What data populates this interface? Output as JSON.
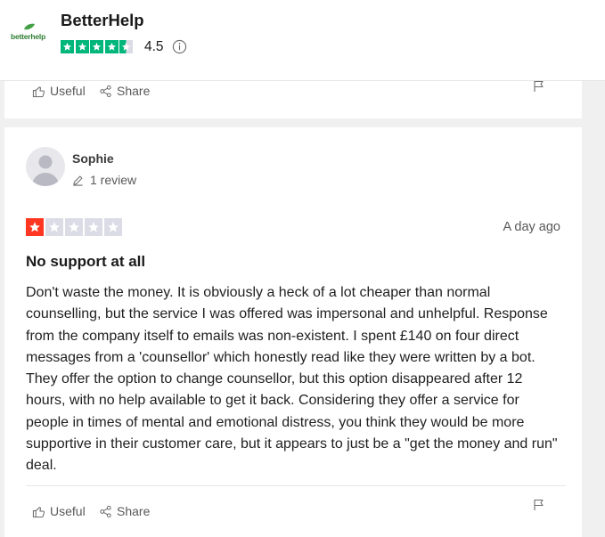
{
  "company": {
    "logo_text": "betterhelp",
    "name": "BetterHelp",
    "rating": "4.5",
    "stars_filled": 4.5,
    "star_color": "#00b67a"
  },
  "actions": {
    "useful_label": "Useful",
    "share_label": "Share"
  },
  "review": {
    "reviewer_name": "Sophie",
    "review_count": "1 review",
    "stars": 1,
    "star_color": "#ff3722",
    "date": "A day ago",
    "title": "No support at all",
    "body": "Don't waste the money. It is obviously a heck of a lot cheaper than normal counselling, but the service I was offered was impersonal and unhelpful. Response from the company itself to emails was non-existent. I spent £140 on four direct messages from a 'counsellor' which honestly read like they were written by a bot. They offer the option to change counsellor, but this option disappeared after 12 hours, with no help available to get it back. Considering they offer a service for people in times of mental and emotional distress, you think they would be more supportive in their customer care, but it appears to just be a \"get the money and run\" deal."
  }
}
